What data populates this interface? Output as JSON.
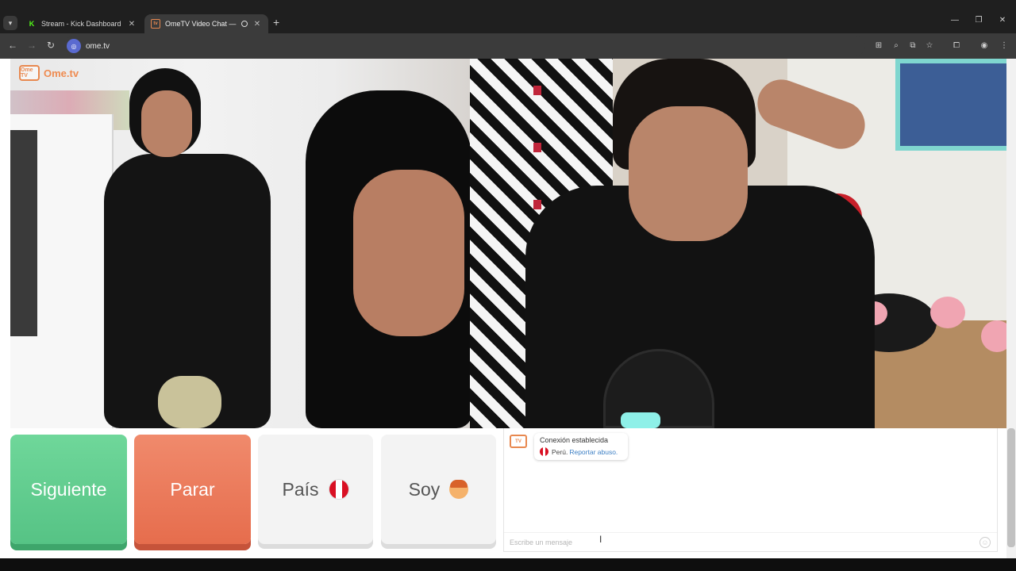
{
  "browser": {
    "tabs": [
      {
        "title": "Stream - Kick Dashboard",
        "favicon": "K",
        "active": false
      },
      {
        "title": "OmeTV Video Chat — Ome",
        "favicon": "tv",
        "active": true
      }
    ],
    "new_tab": "+",
    "url": "ome.tv"
  },
  "logo": {
    "badge": "Ome TV",
    "text": "Ome.tv"
  },
  "controls": {
    "next_label": "Siguiente",
    "stop_label": "Parar",
    "country_label": "País",
    "gender_label": "Soy"
  },
  "chat": {
    "connection_text": "Conexión establecida",
    "country_name": "Perú.",
    "report_text": "Reportar abuso.",
    "input_placeholder": "Escribe un mensaje"
  },
  "colors": {
    "next": "#5ccb8b",
    "stop": "#ea7757",
    "brand": "#ef8b50",
    "peru_red": "#d91023"
  }
}
